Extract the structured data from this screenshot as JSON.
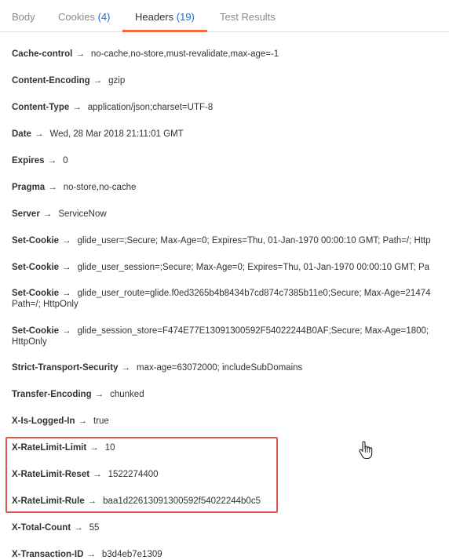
{
  "tabs": [
    {
      "label": "Body",
      "count": "",
      "active": false
    },
    {
      "label": "Cookies",
      "count": "(4)",
      "active": false
    },
    {
      "label": "Headers",
      "count": "(19)",
      "active": true
    },
    {
      "label": "Test Results",
      "count": "",
      "active": false
    }
  ],
  "arrow": "→",
  "headers": [
    {
      "key": "Cache-control",
      "value": "no-cache,no-store,must-revalidate,max-age=-1"
    },
    {
      "key": "Content-Encoding",
      "value": "gzip"
    },
    {
      "key": "Content-Type",
      "value": "application/json;charset=UTF-8"
    },
    {
      "key": "Date",
      "value": "Wed, 28 Mar 2018 21:11:01 GMT"
    },
    {
      "key": "Expires",
      "value": "0"
    },
    {
      "key": "Pragma",
      "value": "no-store,no-cache"
    },
    {
      "key": "Server",
      "value": "ServiceNow"
    },
    {
      "key": "Set-Cookie",
      "value": "glide_user=;Secure; Max-Age=0; Expires=Thu, 01-Jan-1970 00:00:10 GMT; Path=/; Http"
    },
    {
      "key": "Set-Cookie",
      "value": "glide_user_session=;Secure; Max-Age=0; Expires=Thu, 01-Jan-1970 00:00:10 GMT; Pa"
    },
    {
      "key": "Set-Cookie",
      "value": "glide_user_route=glide.f0ed3265b4b8434b7cd874c7385b11e0;Secure; Max-Age=21474",
      "value2": "Path=/; HttpOnly"
    },
    {
      "key": "Set-Cookie",
      "value": "glide_session_store=F474E77E13091300592F54022244B0AF;Secure; Max-Age=1800;",
      "value2": "HttpOnly"
    },
    {
      "key": "Strict-Transport-Security",
      "value": "max-age=63072000; includeSubDomains"
    },
    {
      "key": "Transfer-Encoding",
      "value": "chunked"
    },
    {
      "key": "X-Is-Logged-In",
      "value": "true"
    },
    {
      "key": "X-RateLimit-Limit",
      "value": "10"
    },
    {
      "key": "X-RateLimit-Reset",
      "value": "1522274400"
    },
    {
      "key": "X-RateLimit-Rule",
      "value": "baa1d22613091300592f54022244b0c5"
    },
    {
      "key": "X-Total-Count",
      "value": "55"
    },
    {
      "key": "X-Transaction-ID",
      "value": "b3d4eb7e1309"
    }
  ],
  "colors": {
    "accent_underline": "#f26b3a",
    "count_blue": "#1d6fd1",
    "highlight_box": "#e1574e"
  },
  "cursor_icon": "hand-pointer-icon"
}
